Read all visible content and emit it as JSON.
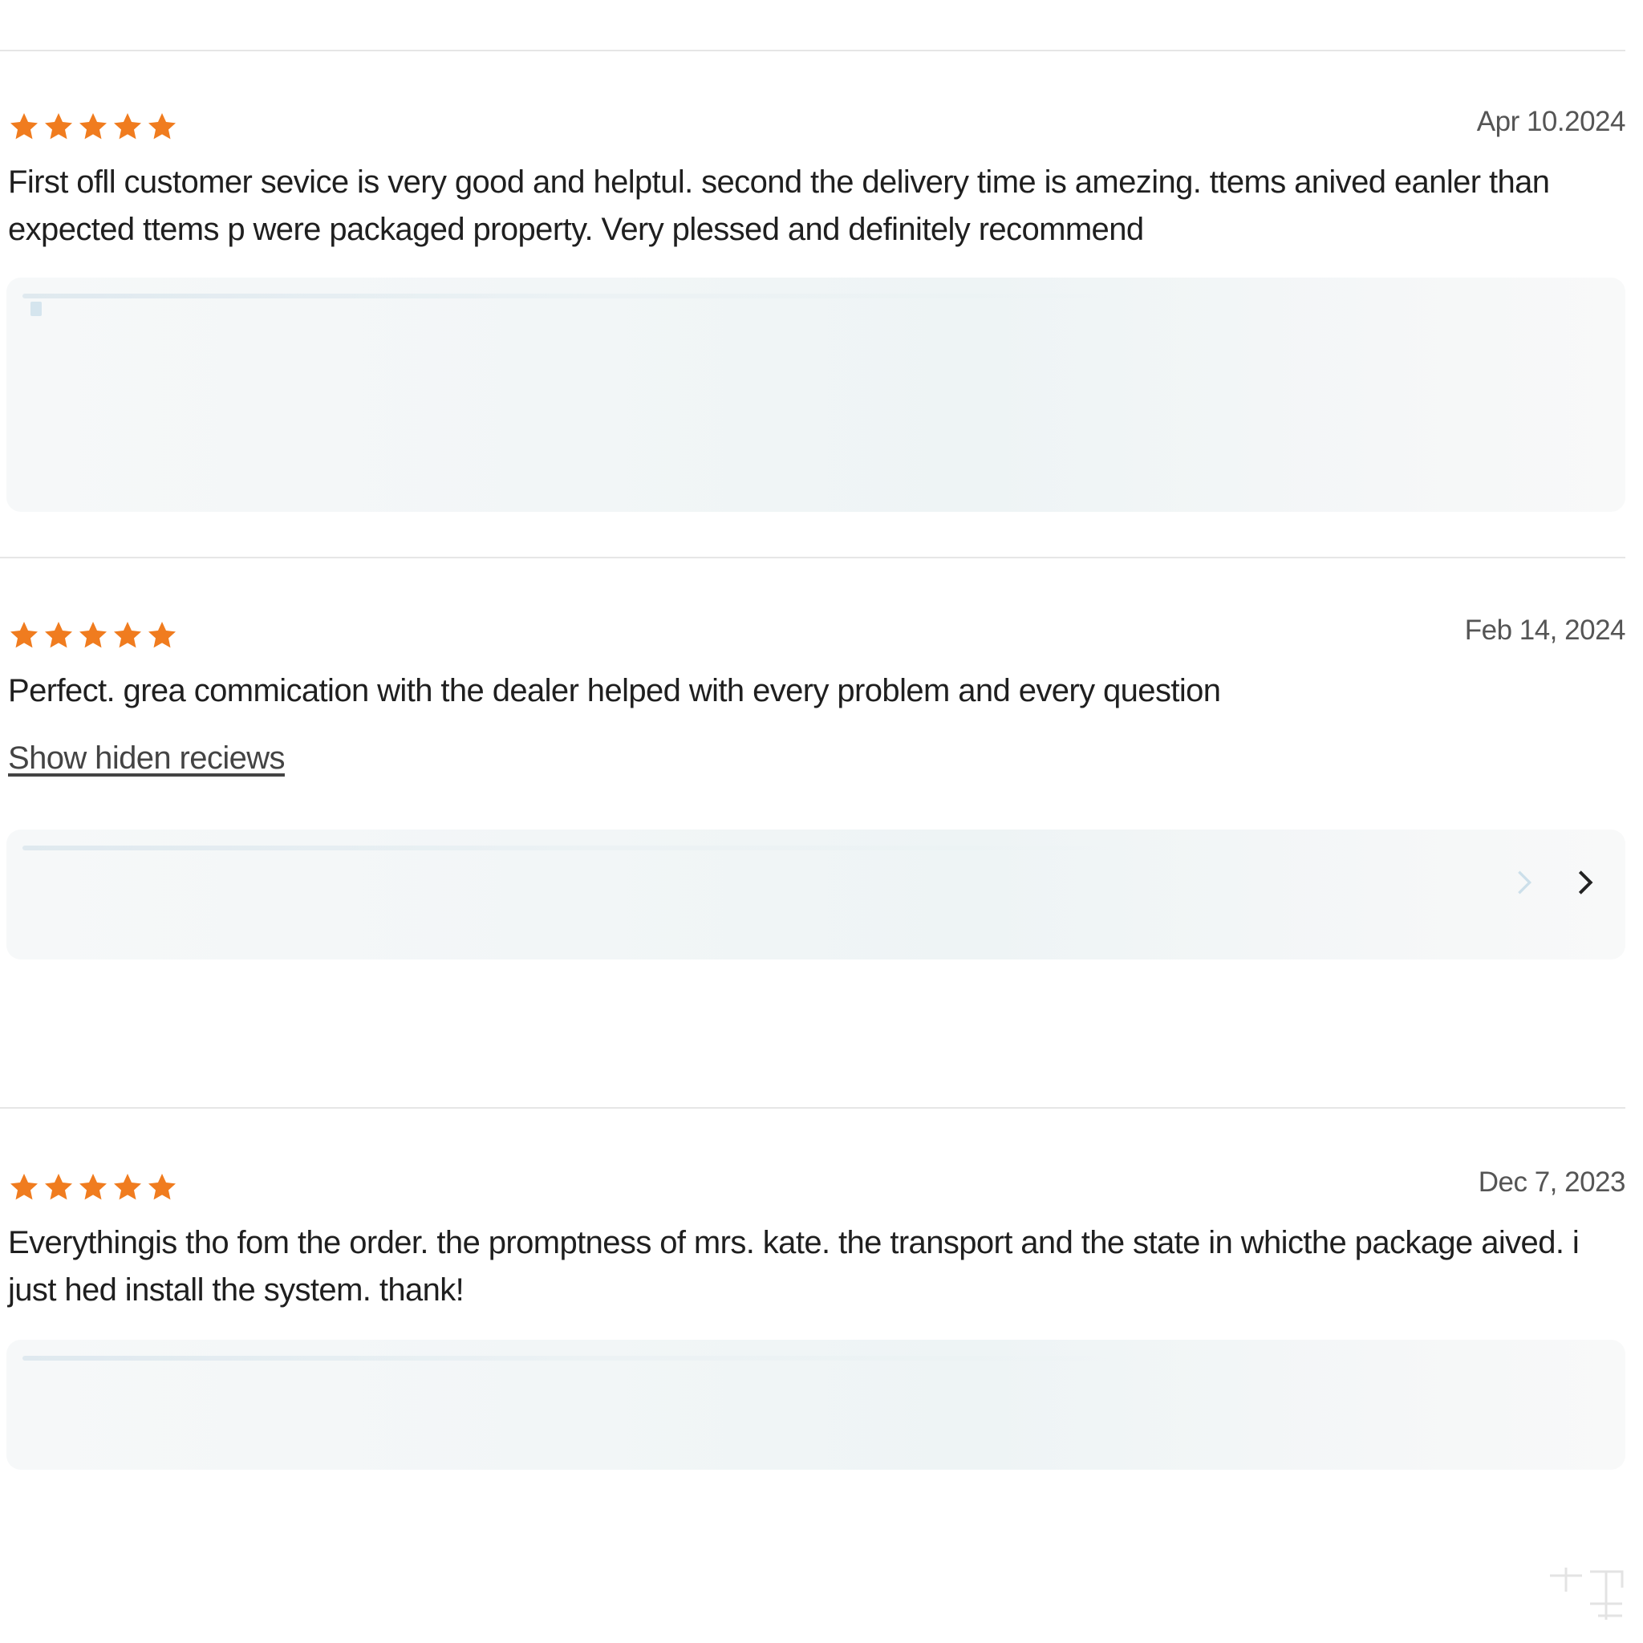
{
  "colors": {
    "star": "#f07c1f",
    "divider": "#e6e6e6",
    "text": "#1f1f1f",
    "date": "#555555"
  },
  "reviews": [
    {
      "rating": 5,
      "date": "Apr 10.2024",
      "text": "First ofll customer sevice is very good and helptul. second the delivery time is amezing. ttems anived eanler than expected ttems p were packaged property. Very plessed and definitely recommend"
    },
    {
      "rating": 5,
      "date": "Feb 14, 2024",
      "text": "Perfect. grea commication with the dealer helped with every problem and every question",
      "show_hidden_label": "Show hiden reciews"
    },
    {
      "rating": 5,
      "date": "Dec 7, 2023",
      "text": "Everythingis tho fom the order. the promptness of mrs. kate. the transport and the state in whicthe package aived. i just hed install the system. thank!"
    }
  ],
  "icons": {
    "star": "star-icon",
    "next": "chevron-right-icon",
    "prev": "chevron-right-faded-icon"
  }
}
